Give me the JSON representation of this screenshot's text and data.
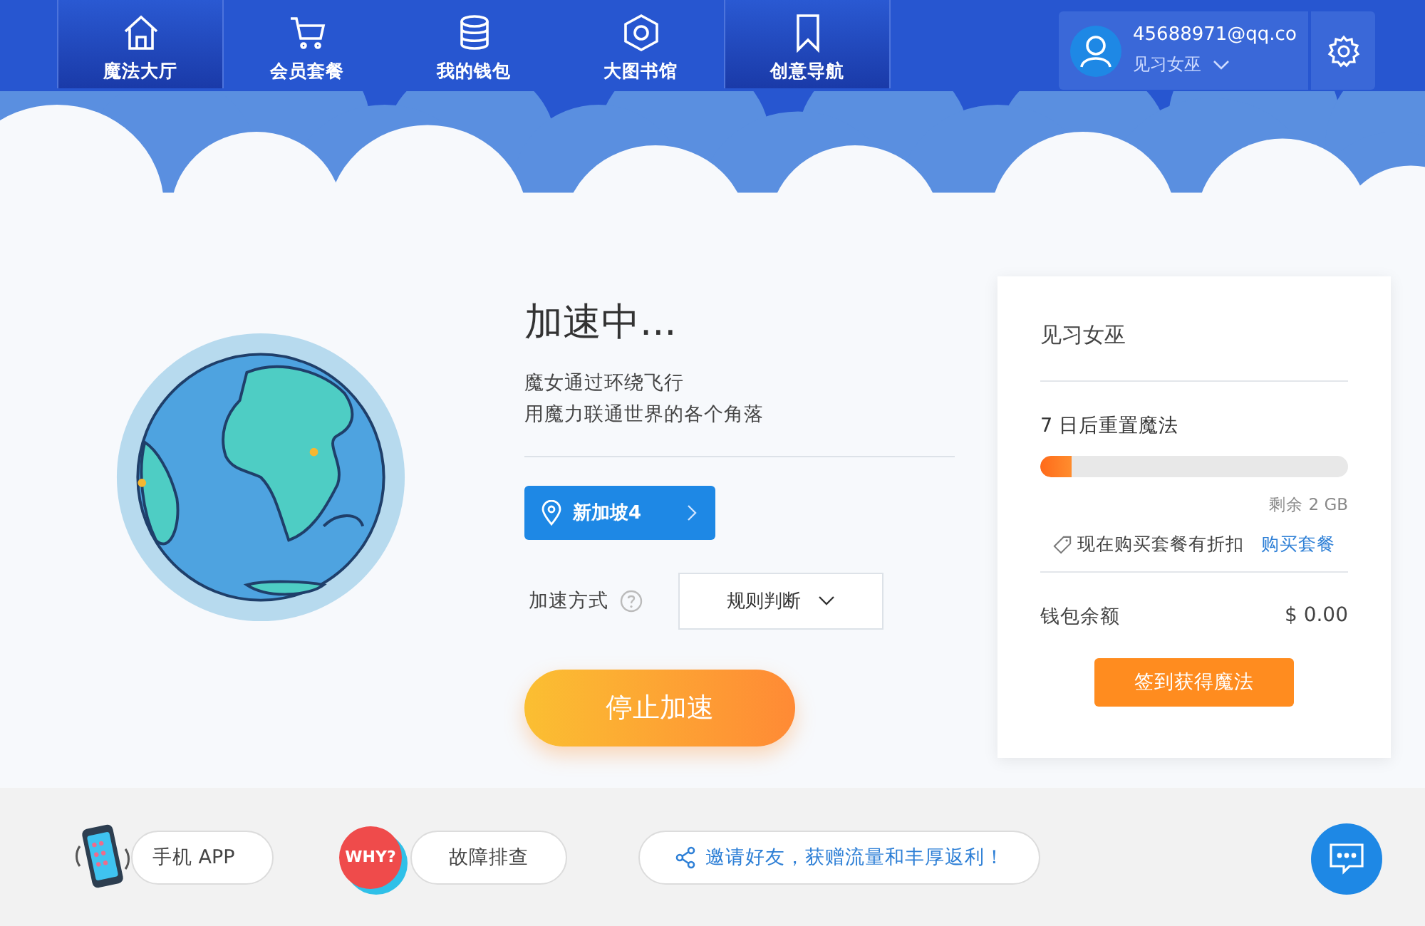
{
  "nav": [
    {
      "label": "魔法大厅",
      "selected": true
    },
    {
      "label": "会员套餐",
      "selected": false
    },
    {
      "label": "我的钱包",
      "selected": false
    },
    {
      "label": "大图书馆",
      "selected": false
    },
    {
      "label": "创意导航",
      "selected": true
    }
  ],
  "account": {
    "email": "45688971@qq.co",
    "level": "见习女巫"
  },
  "status": {
    "title": "加速中...",
    "lines": [
      "魔女通过环绕飞行",
      "用魔力联通世界的各个角落"
    ],
    "server": "新加坡4",
    "mode_label": "加速方式",
    "mode_value": "规则判断",
    "stop_button": "停止加速"
  },
  "card": {
    "title": "见习女巫",
    "reset_text": "7 日后重置魔法",
    "usage": {
      "level": 0.1
    },
    "remaining": "剩余 2 GB",
    "promo": "现在购买套餐有折扣",
    "buy_link": "购买套餐",
    "wallet_label": "钱包余额",
    "wallet_value": "$ 0.00",
    "checkin_button": "签到获得魔法"
  },
  "footer": {
    "app_label": "手机 APP",
    "why_badge": "WHY?",
    "trouble_label": "故障排查",
    "invite_text": "邀请好友，获赠流量和丰厚返利！"
  }
}
